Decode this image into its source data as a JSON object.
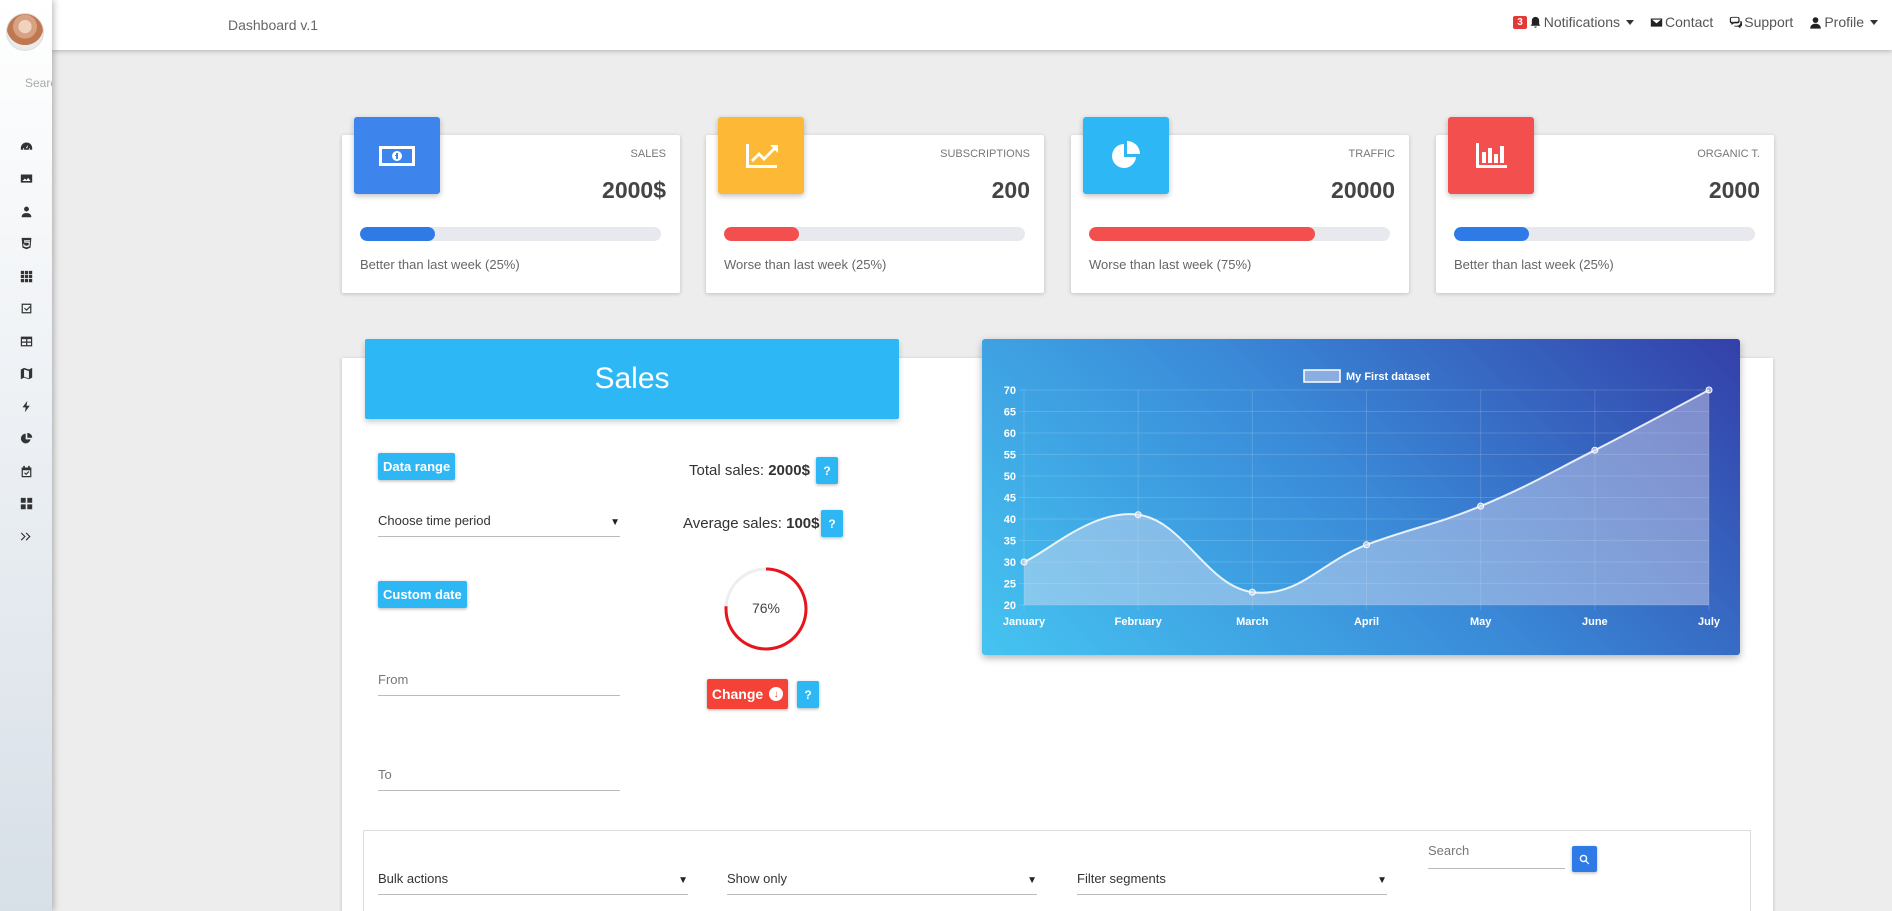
{
  "sidebar": {
    "search_placeholder": "Search",
    "icons": [
      "dashboard-icon",
      "image-icon",
      "user-icon",
      "html5-icon",
      "grid-icon",
      "checkbox-icon",
      "table-icon",
      "map-icon",
      "bolt-icon",
      "pie-chart-icon",
      "calendar-check-icon",
      "widgets-icon",
      "expand-icon"
    ]
  },
  "header": {
    "brand": "Dashboard v.1",
    "notifications_count": "3",
    "notifications_label": "Notifications",
    "contact_label": "Contact",
    "support_label": "Support",
    "profile_label": "Profile"
  },
  "stats": [
    {
      "label": "SALES",
      "value": "2000$",
      "progress": 0.25,
      "bar_color": "#2e7be8",
      "icon_bg": "#3d84ec",
      "description": "Better than last week (25%)",
      "icon": "money-icon"
    },
    {
      "label": "SUBSCRIPTIONS",
      "value": "200",
      "progress": 0.25,
      "bar_color": "#f44f4f",
      "icon_bg": "#fdb935",
      "description": "Worse than last week (25%)",
      "icon": "trending-up-icon"
    },
    {
      "label": "TRAFFIC",
      "value": "20000",
      "progress": 0.75,
      "bar_color": "#f44f4f",
      "icon_bg": "#2db7f5",
      "description": "Worse than last week (75%)",
      "icon": "pie-chart-icon"
    },
    {
      "label": "ORGANIC T.",
      "value": "2000",
      "progress": 0.25,
      "bar_color": "#2e7be8",
      "icon_bg": "#f44f4f",
      "description": "Better than last week (25%)",
      "icon": "bar-chart-icon"
    }
  ],
  "sales": {
    "title": "Sales",
    "data_range_label": "Data range",
    "time_period_placeholder": "Choose time period",
    "custom_date_label": "Custom date",
    "from_placeholder": "From",
    "to_placeholder": "To",
    "total_label": "Total sales:",
    "total_value": "2000$",
    "average_label": "Average sales:",
    "average_value": "100$",
    "help_label": "?",
    "gauge_text": "76%",
    "gauge_value": 0.76,
    "change_label": "Change"
  },
  "chart_data": {
    "type": "line",
    "categories": [
      "January",
      "February",
      "March",
      "April",
      "May",
      "June",
      "July"
    ],
    "series": [
      {
        "name": "My First dataset",
        "values": [
          30,
          41,
          23,
          34,
          43,
          56,
          70
        ]
      }
    ],
    "ylim": [
      20,
      70
    ],
    "yticks": [
      20,
      25,
      30,
      35,
      40,
      45,
      50,
      55,
      60,
      65,
      70
    ],
    "legend": "top",
    "grid": true
  },
  "filters": {
    "bulk_actions": "Bulk actions",
    "show_only": "Show only",
    "filter_segments": "Filter segments",
    "search_placeholder": "Search"
  }
}
